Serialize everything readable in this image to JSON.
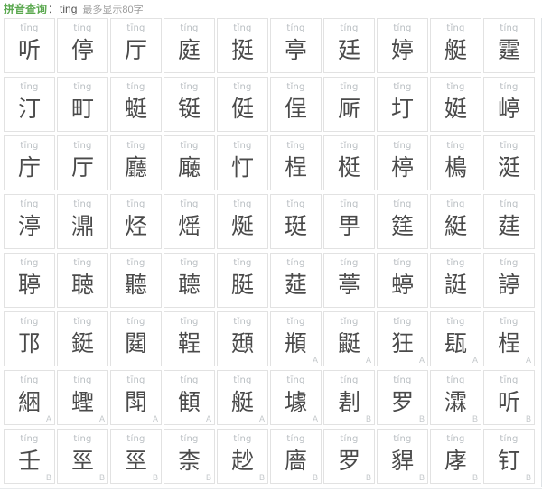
{
  "header": {
    "query_label": "拼音查询",
    "colon": "：",
    "query_value": "ting",
    "note": "最多显示80字"
  },
  "colors": {
    "accent_green": "#5aa84f",
    "pinyin_gray": "#b9bec2",
    "hanzi_gray": "#4a4a4a",
    "badge_gray": "#c4c8cb",
    "cell_border": "#e2e2e2"
  },
  "grid": {
    "columns": 10,
    "rows": 8,
    "total_cells": 80,
    "cells": [
      {
        "pinyin": "tīng",
        "char": "听",
        "badge": ""
      },
      {
        "pinyin": "tíng",
        "char": "停",
        "badge": ""
      },
      {
        "pinyin": "tīng",
        "char": "厅",
        "badge": ""
      },
      {
        "pinyin": "tíng",
        "char": "庭",
        "badge": ""
      },
      {
        "pinyin": "tǐng",
        "char": "挺",
        "badge": ""
      },
      {
        "pinyin": "tíng",
        "char": "亭",
        "badge": ""
      },
      {
        "pinyin": "tíng",
        "char": "廷",
        "badge": ""
      },
      {
        "pinyin": "tíng",
        "char": "婷",
        "badge": ""
      },
      {
        "pinyin": "tǐng",
        "char": "艇",
        "badge": ""
      },
      {
        "pinyin": "tíng",
        "char": "霆",
        "badge": ""
      },
      {
        "pinyin": "tīng",
        "char": "汀",
        "badge": ""
      },
      {
        "pinyin": "tīng",
        "char": "町",
        "badge": ""
      },
      {
        "pinyin": "tíng",
        "char": "蜓",
        "badge": ""
      },
      {
        "pinyin": "tǐng",
        "char": "铤",
        "badge": ""
      },
      {
        "pinyin": "tǐng",
        "char": "侹",
        "badge": ""
      },
      {
        "pinyin": "tǐng",
        "char": "侱",
        "badge": ""
      },
      {
        "pinyin": "tīng",
        "char": "厛",
        "badge": ""
      },
      {
        "pinyin": "tǐng",
        "char": "圢",
        "badge": ""
      },
      {
        "pinyin": "tǐng",
        "char": "娗",
        "badge": ""
      },
      {
        "pinyin": "tíng",
        "char": "嵉",
        "badge": ""
      },
      {
        "pinyin": "tīng",
        "char": "庁",
        "badge": ""
      },
      {
        "pinyin": "tīng",
        "char": "厅",
        "badge": ""
      },
      {
        "pinyin": "tīng",
        "char": "廳",
        "badge": ""
      },
      {
        "pinyin": "tīng",
        "char": "廰",
        "badge": ""
      },
      {
        "pinyin": "tīng",
        "char": "忊",
        "badge": ""
      },
      {
        "pinyin": "tīng",
        "char": "桯",
        "badge": ""
      },
      {
        "pinyin": "tǐng",
        "char": "梃",
        "badge": ""
      },
      {
        "pinyin": "tíng",
        "char": "楟",
        "badge": ""
      },
      {
        "pinyin": "tíng",
        "char": "樢",
        "badge": ""
      },
      {
        "pinyin": "tīng",
        "char": "涏",
        "badge": ""
      },
      {
        "pinyin": "tíng",
        "char": "渟",
        "badge": ""
      },
      {
        "pinyin": "tǐng",
        "char": "濎",
        "badge": ""
      },
      {
        "pinyin": "tīng",
        "char": "烃",
        "badge": ""
      },
      {
        "pinyin": "tīng",
        "char": "熎",
        "badge": ""
      },
      {
        "pinyin": "tǐng",
        "char": "烻",
        "badge": ""
      },
      {
        "pinyin": "tǐng",
        "char": "珽",
        "badge": ""
      },
      {
        "pinyin": "tīng",
        "char": "甼",
        "badge": ""
      },
      {
        "pinyin": "tíng",
        "char": "筳",
        "badge": ""
      },
      {
        "pinyin": "tīng",
        "char": "綎",
        "badge": ""
      },
      {
        "pinyin": "tíng",
        "char": "莛",
        "badge": ""
      },
      {
        "pinyin": "tíng",
        "char": "聤",
        "badge": ""
      },
      {
        "pinyin": "tīng",
        "char": "聴",
        "badge": ""
      },
      {
        "pinyin": "tīng",
        "char": "聽",
        "badge": ""
      },
      {
        "pinyin": "tīng",
        "char": "聼",
        "badge": ""
      },
      {
        "pinyin": "tǐng",
        "char": "脡",
        "badge": ""
      },
      {
        "pinyin": "tíng",
        "char": "莚",
        "badge": ""
      },
      {
        "pinyin": "tíng",
        "char": "葶",
        "badge": ""
      },
      {
        "pinyin": "tíng",
        "char": "蝏",
        "badge": ""
      },
      {
        "pinyin": "tǐng",
        "char": "誔",
        "badge": ""
      },
      {
        "pinyin": "tíng",
        "char": "諪",
        "badge": ""
      },
      {
        "pinyin": "tíng",
        "char": "邒",
        "badge": ""
      },
      {
        "pinyin": "tǐng",
        "char": "鋌",
        "badge": ""
      },
      {
        "pinyin": "tíng",
        "char": "閮",
        "badge": ""
      },
      {
        "pinyin": "tīng",
        "char": "鞓",
        "badge": ""
      },
      {
        "pinyin": "tǐng",
        "char": "頲",
        "badge": ""
      },
      {
        "pinyin": "tǐng",
        "char": "頩",
        "badge": "A"
      },
      {
        "pinyin": "tǐng",
        "char": "鼮",
        "badge": "A"
      },
      {
        "pinyin": "tǐng",
        "char": "狂",
        "badge": "A"
      },
      {
        "pinyin": "tǐng",
        "char": "瓺",
        "badge": "A"
      },
      {
        "pinyin": "tīng",
        "char": "桯",
        "badge": "A"
      },
      {
        "pinyin": "tíng",
        "char": "綑",
        "badge": "A"
      },
      {
        "pinyin": "tíng",
        "char": "蟶",
        "badge": "A"
      },
      {
        "pinyin": "tīng",
        "char": "閗",
        "badge": "A"
      },
      {
        "pinyin": "tíng",
        "char": "顀",
        "badge": "A"
      },
      {
        "pinyin": "tǐng",
        "char": "艇",
        "badge": "A"
      },
      {
        "pinyin": "tīng",
        "char": "壉",
        "badge": "A"
      },
      {
        "pinyin": "tíng",
        "char": "剨",
        "badge": "B"
      },
      {
        "pinyin": "tíng",
        "char": "罗",
        "badge": "B"
      },
      {
        "pinyin": "tíng",
        "char": "瀮",
        "badge": "B"
      },
      {
        "pinyin": "tīng",
        "char": "听",
        "badge": "B"
      },
      {
        "pinyin": "tíng",
        "char": "壬",
        "badge": "B"
      },
      {
        "pinyin": "tíng",
        "char": "巠",
        "badge": "B"
      },
      {
        "pinyin": "tíng",
        "char": "巠",
        "badge": "B"
      },
      {
        "pinyin": "tíng",
        "char": "柰",
        "badge": "B"
      },
      {
        "pinyin": "tíng",
        "char": "赻",
        "badge": "B"
      },
      {
        "pinyin": "tíng",
        "char": "廧",
        "badge": "B"
      },
      {
        "pinyin": "tíng",
        "char": "罗",
        "badge": "B"
      },
      {
        "pinyin": "tíng",
        "char": "貋",
        "badge": "B"
      },
      {
        "pinyin": "tíng",
        "char": "庨",
        "badge": "B"
      },
      {
        "pinyin": "tíng",
        "char": "钉",
        "badge": "B"
      }
    ]
  }
}
